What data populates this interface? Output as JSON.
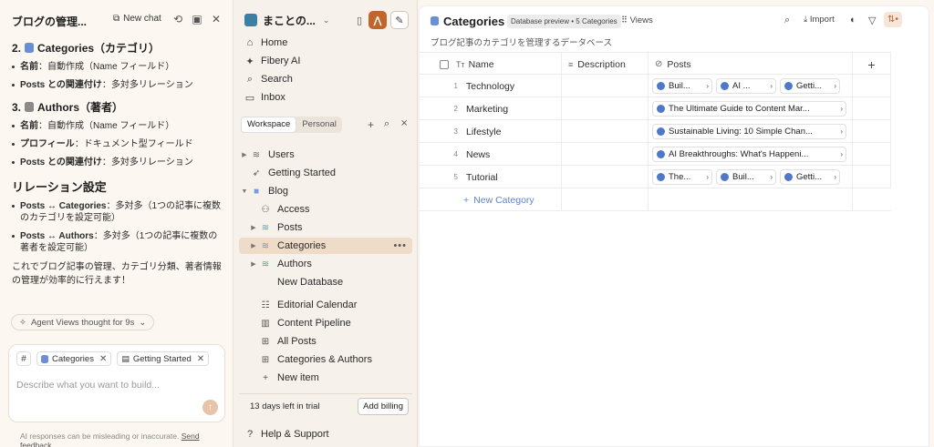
{
  "chat": {
    "title": "ブログの管理...",
    "new_chat": "New chat",
    "sections": [
      {
        "num": "2.",
        "title": "Categories（カテゴリ）",
        "icon": "blue",
        "items": [
          {
            "key": "名前",
            "val": "：自動作成（Name フィールド）"
          },
          {
            "key": "Posts との関連付け",
            "val": "：多対多リレーション"
          }
        ]
      },
      {
        "num": "3.",
        "title": "Authors（著者）",
        "icon": "gray",
        "items": [
          {
            "key": "名前",
            "val": "：自動作成（Name フィールド）"
          },
          {
            "key": "プロフィール",
            "val": "：ドキュメント型フィールド"
          },
          {
            "key": "Posts との関連付け",
            "val": "：多対多リレーション"
          }
        ]
      }
    ],
    "relations_heading": "リレーション設定",
    "relations": [
      {
        "key": "Posts ↔ Categories",
        "val": "：多対多（1つの記事に複数のカテゴリを設定可能）"
      },
      {
        "key": "Posts ↔ Authors",
        "val": "：多対多（1つの記事に複数の著者を設定可能）"
      }
    ],
    "closing": "これでブログ記事の管理、カテゴリ分類、著者情報の管理が効率的に行えます！",
    "thought": "Agent Views thought for 9s",
    "chips": [
      "Categories",
      "Getting Started"
    ],
    "placeholder": "Describe what you want to build...",
    "disclaimer": "AI responses can be misleading or inaccurate.",
    "feedback": "Send feedback."
  },
  "sidebar": {
    "workspace": "まことの...",
    "nav": [
      {
        "label": "Home",
        "icon": "home-icon"
      },
      {
        "label": "Fibery AI",
        "icon": "sparkle-icon"
      },
      {
        "label": "Search",
        "icon": "search-icon"
      },
      {
        "label": "Inbox",
        "icon": "inbox-icon"
      }
    ],
    "tabs": [
      "Workspace",
      "Personal"
    ],
    "tree": [
      {
        "label": "Users",
        "caret": "▶",
        "icon": "database-icon",
        "indent": 0
      },
      {
        "label": "Getting Started",
        "caret": "",
        "icon": "rocket-icon",
        "indent": 0
      },
      {
        "label": "Blog",
        "caret": "▼",
        "icon": "space-icon",
        "indent": 0
      },
      {
        "label": "Access",
        "caret": "",
        "icon": "users-icon",
        "indent": 1
      },
      {
        "label": "Posts",
        "caret": "▶",
        "icon": "database-icon",
        "indent": 1
      },
      {
        "label": "Categories",
        "caret": "▶",
        "icon": "database-icon",
        "indent": 1,
        "active": true
      },
      {
        "label": "Authors",
        "caret": "▶",
        "icon": "database-icon",
        "indent": 1
      },
      {
        "label": "New Database",
        "caret": "",
        "icon": "",
        "indent": 1
      },
      {
        "label": "Editorial Calendar",
        "caret": "",
        "icon": "calendar-icon",
        "indent": 1
      },
      {
        "label": "Content Pipeline",
        "caret": "",
        "icon": "board-icon",
        "indent": 1
      },
      {
        "label": "All Posts",
        "caret": "",
        "icon": "grid-icon",
        "indent": 1
      },
      {
        "label": "Categories & Authors",
        "caret": "",
        "icon": "grid-icon",
        "indent": 1
      },
      {
        "label": "New item",
        "caret": "",
        "icon": "plus-icon",
        "indent": 1
      }
    ],
    "trial_text": "13 days left in trial",
    "billing": "Add billing",
    "help": "Help & Support"
  },
  "main": {
    "title": "Categories",
    "badge": "Database preview • 5 Categories",
    "views": "Views",
    "import": "Import",
    "subtitle": "ブログ記事のカテゴリを管理するデータベース",
    "columns": [
      "Name",
      "Description",
      "Posts"
    ],
    "rows": [
      {
        "n": "1",
        "name": "Technology",
        "posts": [
          "Buil...",
          "AI ...",
          "Getti..."
        ]
      },
      {
        "n": "2",
        "name": "Marketing",
        "posts": [
          "The Ultimate Guide to Content Mar..."
        ]
      },
      {
        "n": "3",
        "name": "Lifestyle",
        "posts": [
          "Sustainable Living: 10 Simple Chan..."
        ]
      },
      {
        "n": "4",
        "name": "News",
        "posts": [
          "AI Breakthroughs: What's Happeni..."
        ]
      },
      {
        "n": "5",
        "name": "Tutorial",
        "posts": [
          "The...",
          "Buil...",
          "Getti..."
        ]
      }
    ],
    "new_category": "New Category"
  },
  "colors": {
    "accent": "#c0652b",
    "link": "#5f84cf",
    "active_bg": "#efdcc8"
  }
}
